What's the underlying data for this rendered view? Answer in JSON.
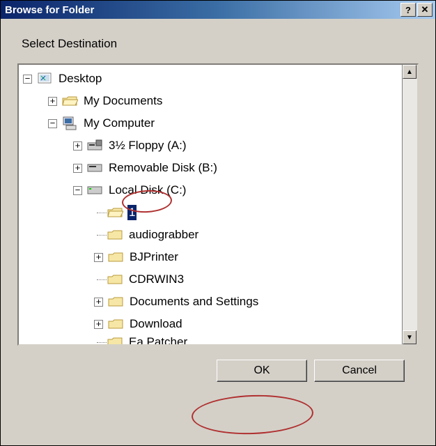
{
  "window": {
    "title": "Browse for Folder"
  },
  "instruction": "Select Destination",
  "tree": {
    "desktop": "Desktop",
    "my_documents": "My Documents",
    "my_computer": "My Computer",
    "floppy": "3½ Floppy (A:)",
    "removable": "Removable Disk (B:)",
    "local_c": "Local Disk (C:)",
    "folder_1": "1",
    "folder_audiograbber": "audiograbber",
    "folder_bjprinter": "BJPrinter",
    "folder_cdrwin3": "CDRWIN3",
    "folder_docsettings": "Documents and Settings",
    "folder_download": "Download",
    "folder_eapatcher": "Ea Patcher"
  },
  "buttons": {
    "ok": "OK",
    "cancel": "Cancel"
  },
  "icons": {
    "help": "?",
    "close": "✕",
    "up": "▲",
    "down": "▼"
  }
}
